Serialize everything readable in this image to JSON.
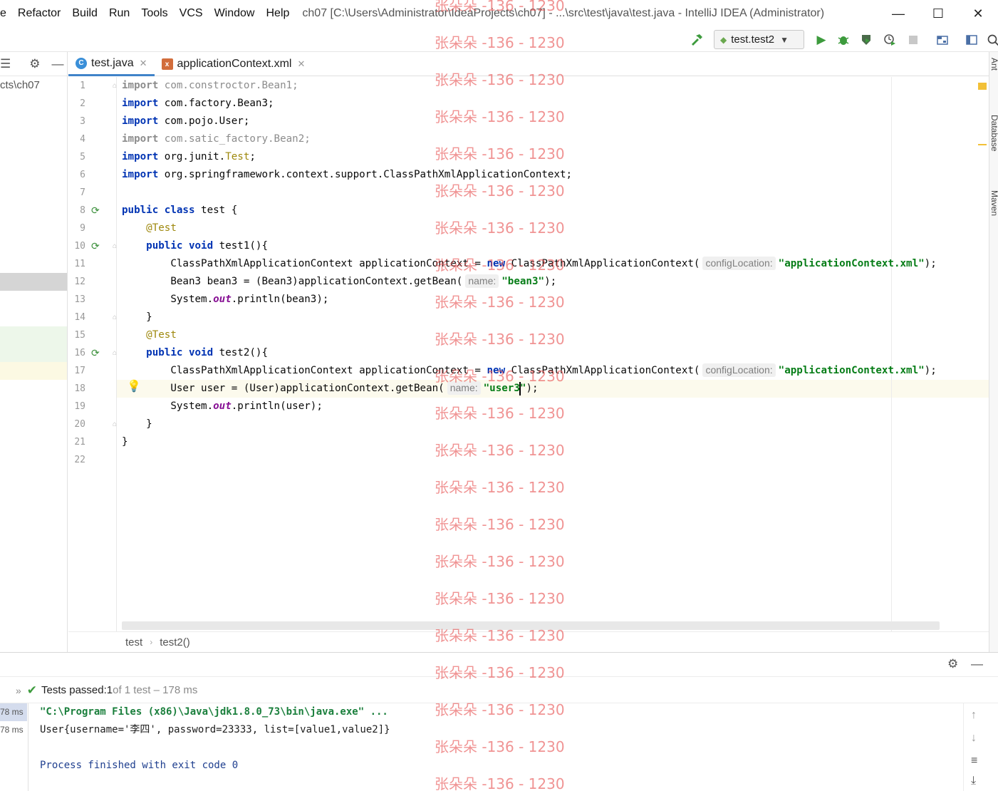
{
  "menu": [
    "e",
    "Refactor",
    "Build",
    "Run",
    "Tools",
    "VCS",
    "Window",
    "Help"
  ],
  "window_title": "ch07 [C:\\Users\\Administrator\\IdeaProjects\\ch07] - ...\\src\\test\\java\\test.java - IntelliJ IDEA (Administrator)",
  "window_controls": {
    "minimize": "—",
    "maximize": "☐",
    "close": "✕"
  },
  "toolbar": {
    "run_config": "test.test2",
    "icons": [
      "hammer-icon",
      "run-icon",
      "debug-icon",
      "coverage-icon",
      "profile-icon",
      "stop-icon",
      "project-structure-icon",
      "window-icon",
      "search-icon"
    ]
  },
  "project_panel": {
    "path": "cts\\ch07"
  },
  "tabs": [
    {
      "label": "test.java",
      "active": true
    },
    {
      "label": "applicationContext.xml",
      "active": false
    }
  ],
  "editor": {
    "line_numbers": [
      "1",
      "2",
      "3",
      "4",
      "5",
      "6",
      "7",
      "8",
      "9",
      "10",
      "11",
      "12",
      "13",
      "14",
      "15",
      "16",
      "17",
      "18",
      "19",
      "20",
      "21",
      "22"
    ],
    "lines": [
      {
        "tokens": [
          {
            "t": "import",
            "c": "kw-unused"
          },
          {
            "t": " com.constroctor.Bean1;",
            "c": "unused"
          }
        ]
      },
      {
        "tokens": [
          {
            "t": "import",
            "c": "kw"
          },
          {
            "t": " com.factory.Bean3;"
          }
        ]
      },
      {
        "tokens": [
          {
            "t": "import",
            "c": "kw"
          },
          {
            "t": " com.pojo.User;"
          }
        ]
      },
      {
        "tokens": [
          {
            "t": "import",
            "c": "kw-unused"
          },
          {
            "t": " com.satic_factory.Bean2;",
            "c": "unused"
          }
        ]
      },
      {
        "tokens": [
          {
            "t": "import",
            "c": "kw"
          },
          {
            "t": " org.junit."
          },
          {
            "t": "Test",
            "c": "ann"
          },
          {
            "t": ";"
          }
        ]
      },
      {
        "tokens": [
          {
            "t": "import",
            "c": "kw"
          },
          {
            "t": " org.springframework.context.support.ClassPathXmlApplicationContext;"
          }
        ]
      },
      {
        "tokens": []
      },
      {
        "tokens": [
          {
            "t": "public",
            "c": "kw"
          },
          {
            "t": " "
          },
          {
            "t": "class",
            "c": "kw"
          },
          {
            "t": " test {"
          }
        ]
      },
      {
        "tokens": [
          {
            "t": "    "
          },
          {
            "t": "@Test",
            "c": "ann"
          }
        ]
      },
      {
        "tokens": [
          {
            "t": "    "
          },
          {
            "t": "public",
            "c": "kw"
          },
          {
            "t": " "
          },
          {
            "t": "void",
            "c": "kw"
          },
          {
            "t": " test1(){"
          }
        ]
      },
      {
        "tokens": [
          {
            "t": "        ClassPathXmlApplicationContext applicationContext = "
          },
          {
            "t": "new",
            "c": "kw"
          },
          {
            "t": " ClassPathXmlApplicationContext("
          },
          {
            "t": "configLocation:",
            "c": "hint"
          },
          {
            "t": "\"applicationContext.xml\"",
            "c": "str"
          },
          {
            "t": ");"
          }
        ]
      },
      {
        "tokens": [
          {
            "t": "        Bean3 bean3 = (Bean3)applicationContext.getBean("
          },
          {
            "t": "name:",
            "c": "hint"
          },
          {
            "t": "\"bean3\"",
            "c": "str"
          },
          {
            "t": ");"
          }
        ]
      },
      {
        "tokens": [
          {
            "t": "        System."
          },
          {
            "t": "out",
            "c": "static-it"
          },
          {
            "t": ".println(bean3);"
          }
        ]
      },
      {
        "tokens": [
          {
            "t": "    }"
          }
        ]
      },
      {
        "tokens": [
          {
            "t": "    "
          },
          {
            "t": "@Test",
            "c": "ann"
          }
        ]
      },
      {
        "tokens": [
          {
            "t": "    "
          },
          {
            "t": "public",
            "c": "kw"
          },
          {
            "t": " "
          },
          {
            "t": "void",
            "c": "kw"
          },
          {
            "t": " test2(){"
          }
        ]
      },
      {
        "tokens": [
          {
            "t": "        ClassPathXmlApplicationContext applicationContext = "
          },
          {
            "t": "new",
            "c": "kw"
          },
          {
            "t": " ClassPathXmlApplicationContext("
          },
          {
            "t": "configLocation:",
            "c": "hint"
          },
          {
            "t": "\"applicationContext.xml\"",
            "c": "str"
          },
          {
            "t": ");"
          }
        ]
      },
      {
        "tokens": [
          {
            "t": "        User user = (User)applicationContext.getBean("
          },
          {
            "t": "name:",
            "c": "hint"
          },
          {
            "t": "\"user3\"",
            "c": "str"
          },
          {
            "t": ");"
          }
        ]
      },
      {
        "tokens": [
          {
            "t": "        System."
          },
          {
            "t": "out",
            "c": "static-it"
          },
          {
            "t": ".println(user);"
          }
        ]
      },
      {
        "tokens": [
          {
            "t": "    }"
          }
        ]
      },
      {
        "tokens": [
          {
            "t": "}"
          }
        ]
      },
      {
        "tokens": []
      }
    ]
  },
  "breadcrumb": [
    "test",
    "test2()"
  ],
  "right_strip": [
    "Ant",
    "Database",
    "Maven"
  ],
  "run_panel": {
    "status_prefix": "Tests passed: ",
    "status_count": "1",
    "status_suffix": " of 1 test – 178 ms",
    "times": [
      "78 ms",
      "78 ms"
    ],
    "console": [
      {
        "text": "\"C:\\Program Files (x86)\\Java\\jdk1.8.0_73\\bin\\java.exe\" ...",
        "color": "#1a7f3c",
        "bold": true
      },
      {
        "text": "User{username='李四', password=23333, list=[value1,value2]}",
        "color": "#1e1e1e"
      },
      {
        "text": "",
        "color": "#1e1e1e"
      },
      {
        "text": "Process finished with exit code 0",
        "color": "#1f3f8f"
      }
    ]
  },
  "watermark": "张朵朵 -136 - 1230",
  "colors": {
    "accent": "#4083c9",
    "keyword": "#0033b3",
    "string": "#067d17",
    "annotation": "#9e880d",
    "watermark": "#e65050",
    "pass": "#3d9b3d"
  }
}
